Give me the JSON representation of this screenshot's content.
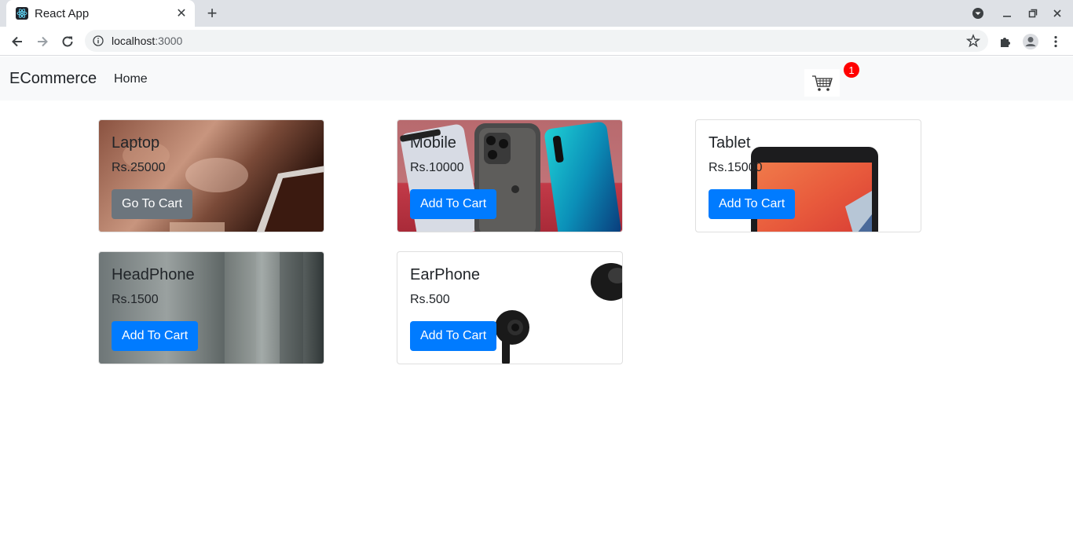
{
  "browser": {
    "tab_title": "React App",
    "url_host": "localhost",
    "url_port": ":3000"
  },
  "navbar": {
    "brand": "ECommerce",
    "home_link": "Home",
    "cart_icon": "shopping-cart-icon",
    "cart_count": "1"
  },
  "products": [
    {
      "name": "Laptop",
      "price": "Rs.25000",
      "button": "Go To Cart"
    },
    {
      "name": "Mobile",
      "price": "Rs.10000",
      "button": "Add To Cart"
    },
    {
      "name": "Tablet",
      "price": "Rs.15000",
      "button": "Add To Cart"
    },
    {
      "name": "HeadPhone",
      "price": "Rs.1500",
      "button": "Add To Cart"
    },
    {
      "name": "EarPhone",
      "price": "Rs.500",
      "button": "Add To Cart"
    }
  ],
  "colors": {
    "primary_button": "#007bff",
    "secondary_button": "#6c757d",
    "badge": "#ff0000",
    "navbar_bg": "#f8f9fa"
  }
}
